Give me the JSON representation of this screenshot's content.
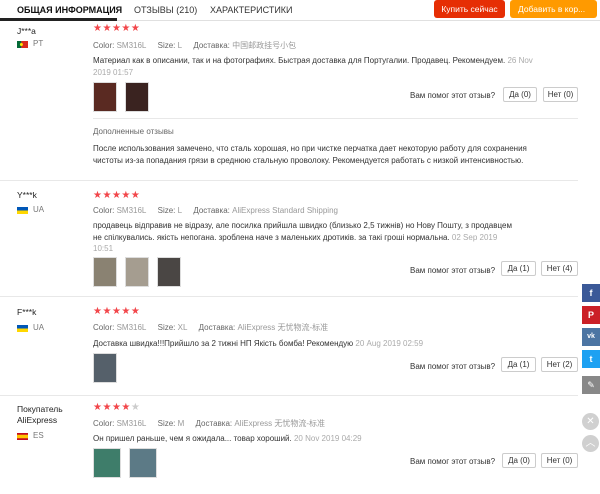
{
  "tabs": [
    {
      "label": "ОБЩАЯ ИНФОРМАЦИЯ"
    },
    {
      "label": "ОТЗЫВЫ (210)"
    },
    {
      "label": "ХАРАКТЕРИСТИКИ"
    }
  ],
  "actions": {
    "buy": "Купить сейчас",
    "cart": "Добавить в кор..."
  },
  "colors": {
    "buy": "#e62e04",
    "cart": "#ff9a00",
    "stars": "#f2464a",
    "facebook": "#3b5998",
    "pinterest": "#cb2027",
    "vk": "#4c75a3",
    "twitter": "#1da1f2"
  },
  "helpful_label": "Вам помог этот отзыв?",
  "reviews": [
    {
      "user": "J***a",
      "country": "PT",
      "flag": "portugal-flag",
      "rating": 5,
      "color_label": "Color:",
      "color": "SM316L",
      "size_label": "Size:",
      "size": "L",
      "delivery_label": "Доставка:",
      "delivery": "中国邮政挂号小包",
      "text": "Материал как в описании, так и на фотографиях. Быстрая доставка для Португалии. Продавец. Рекомендуем.",
      "date": "26 Nov 2019 01:57",
      "yes": "Да (0)",
      "no": "Нет (0)",
      "additional_heading": "Дополненные отзывы",
      "additional_text": "После использования замечено, что сталь хорошая, но при чистке перчатка дает некоторую работу для сохранения чистоты из-за попадания грязи в среднюю стальную проволоку. Рекомендуется работать с низкой интенсивностью."
    },
    {
      "user": "Y***k",
      "country": "UA",
      "flag": "ukraine-flag",
      "rating": 5,
      "color_label": "Color:",
      "color": "SM316L",
      "size_label": "Size:",
      "size": "L",
      "delivery_label": "Доставка:",
      "delivery": "AliExpress Standard Shipping",
      "text": "продавець відправив не відразу, але посилка прийшла швидко (близько 2,5 тижнів) но Нову Пошту, з продавцем не спілкувались. якість непогана. зроблена наче з маленьких дротиків. за такі гроші нормальна.",
      "date": "02 Sep 2019 10:51",
      "yes": "Да (1)",
      "no": "Нет (4)"
    },
    {
      "user": "F***k",
      "country": "UA",
      "flag": "ukraine-flag",
      "rating": 5,
      "color_label": "Color:",
      "color": "SM316L",
      "size_label": "Size:",
      "size": "XL",
      "delivery_label": "Доставка:",
      "delivery": "AliExpress 无忧物流-标准",
      "text": "Доставка швидка!!!Прийшло за 2 тижні НП Якість бомба! Рекомендую",
      "date": "20 Aug 2019 02:59",
      "yes": "Да (1)",
      "no": "Нет (2)"
    },
    {
      "user": "Покупатель AliExpress",
      "country": "ES",
      "flag": "spain-flag",
      "rating": 4,
      "color_label": "Color:",
      "color": "SM316L",
      "size_label": "Size:",
      "size": "M",
      "delivery_label": "Доставка:",
      "delivery": "AliExpress 无忧物流-标准",
      "text": "Он пришел раньше, чем я ожидала... товар хороший.",
      "date": "20 Nov 2019 04:29",
      "yes": "Да (0)",
      "no": "Нет (0)"
    }
  ],
  "share": {
    "facebook": "f",
    "pinterest": "P",
    "vk": "vk",
    "twitter": "t",
    "edit": "✎",
    "close": "✕",
    "up": "︿"
  }
}
